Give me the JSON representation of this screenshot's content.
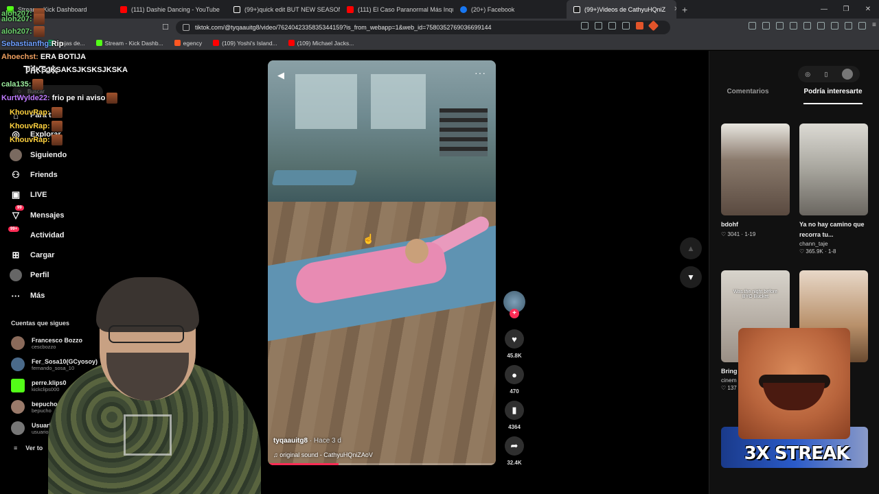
{
  "browser": {
    "tabs": [
      {
        "title": "Stream - Kick Dashboard",
        "color": "#53fc18"
      },
      {
        "title": "(111) Dashie Dancing - YouTube",
        "color": "#ff0000"
      },
      {
        "title": "(99+)quick edit BUT NEW SEASON IS",
        "color": "#ffffff"
      },
      {
        "title": "(111) El Caso Paranormal Más Inquie",
        "color": "#ff0000"
      },
      {
        "title": "(20+) Facebook",
        "color": "#1877f2"
      },
      {
        "title": "(99+)Videos de CathyuHQniZ",
        "color": "#ffffff"
      }
    ],
    "url": "tiktok.com/@tyqaauitg8/video/7624042335835344159?is_from_webapp=1&web_id=7580352769036699144",
    "bookmarks": [
      {
        "label": "Hojas de...",
        "color": "#0f9d58"
      },
      {
        "label": "Stream - Kick Dashb...",
        "color": "#53fc18"
      },
      {
        "label": "egency",
        "color": "#ff5722"
      },
      {
        "label": "(109) Yoshi's Island...",
        "color": "#ff0000"
      },
      {
        "label": "(109) Michael Jacks...",
        "color": "#ff0000"
      }
    ]
  },
  "chat": [
    {
      "user": "aloh207:",
      "text": "",
      "color": "#6fd46f"
    },
    {
      "user": "aloh207:",
      "text": "",
      "color": "#6fd46f"
    },
    {
      "user": "aloh207:",
      "text": "",
      "color": "#6fd46f"
    },
    {
      "user": "Sebastianfhg:",
      "text": "Rip",
      "color": "#6fa0ff"
    },
    {
      "user": "Ahoechst:",
      "text": "ERA BOTIJA",
      "color": "#f0a060"
    },
    {
      "user": "",
      "text": "JAKSJKSAKSJKSKSJKSKA",
      "color": "#ffffff"
    },
    {
      "user": "cala135:",
      "text": "",
      "color": "#9ef0a0"
    },
    {
      "user": "KurtWylde22:",
      "text": "frio pe ni aviso",
      "color": "#c07cff"
    },
    {
      "user": "KhouvRap:",
      "text": "",
      "color": "#ffd23f"
    },
    {
      "user": "KhouvRap:",
      "text": "",
      "color": "#ffd23f"
    },
    {
      "user": "KhouvRap:",
      "text": "",
      "color": "#ffd23f"
    }
  ],
  "nav": {
    "logo": "TikTok",
    "search_placeholder": "Buscar",
    "items": [
      {
        "label": "Para ti",
        "icon": "home-icon"
      },
      {
        "label": "Explorar",
        "icon": "compass-icon"
      },
      {
        "label": "Siguiendo",
        "icon": "following-icon"
      },
      {
        "label": "Friends",
        "icon": "friends-icon"
      },
      {
        "label": "LIVE",
        "icon": "live-icon"
      },
      {
        "label": "Mensajes",
        "icon": "messages-icon",
        "badge": "99"
      },
      {
        "label": "Actividad",
        "icon": "activity-icon",
        "badge": "99+"
      },
      {
        "label": "Cargar",
        "icon": "upload-icon"
      },
      {
        "label": "Perfil",
        "icon": "profile-icon"
      },
      {
        "label": "Más",
        "icon": "more-icon"
      }
    ]
  },
  "following": {
    "title": "Cuentas que sigues",
    "accounts": [
      {
        "name": "Francesco Bozzo",
        "handle": "cescbozzo",
        "color": "#8a6a5a"
      },
      {
        "name": "Fer_Sosa10(GCyosoy)",
        "handle": "fernando_sosa_10",
        "color": "#4a6a8a"
      },
      {
        "name": "perre.klips0",
        "handle": "kickclips000",
        "color": "#53fc18"
      },
      {
        "name": "bepucho",
        "handle": "bepucho",
        "color": "#9a7a6a"
      },
      {
        "name": "Usuario",
        "handle": "usuario0",
        "color": "#777777"
      }
    ],
    "see_all": "Ver to"
  },
  "video": {
    "author": "tyqaauitg8",
    "ago": "· Hace 3 d",
    "sound": "original sound - CathyuHQniZAoV",
    "progress": 0.31
  },
  "actions": {
    "likes": "45.8K",
    "comments": "470",
    "saves": "4364",
    "shares": "32.4K"
  },
  "right": {
    "tabs": [
      "Comentarios",
      "Podría interesarte"
    ],
    "cards": [
      {
        "caption": "bdohf",
        "author": "",
        "likes": "3041",
        "date": "1-19",
        "thumb": "#8a7a6c"
      },
      {
        "caption": "Ya no hay camino que recorra tu...",
        "author": "chann_taje",
        "likes": "365.9K",
        "date": "1-8",
        "thumb": "#a7a59d"
      },
      {
        "caption": "Bring",
        "author": "cinem",
        "likes": "137",
        "date": "",
        "thumb": "#9a8f85",
        "overlay": "Was the night before BYO Bucket"
      },
      {
        "caption": "",
        "author": "",
        "likes": "",
        "date": "",
        "thumb": "#b8906a"
      }
    ]
  },
  "overlay": {
    "streak": "3X STREAK"
  }
}
